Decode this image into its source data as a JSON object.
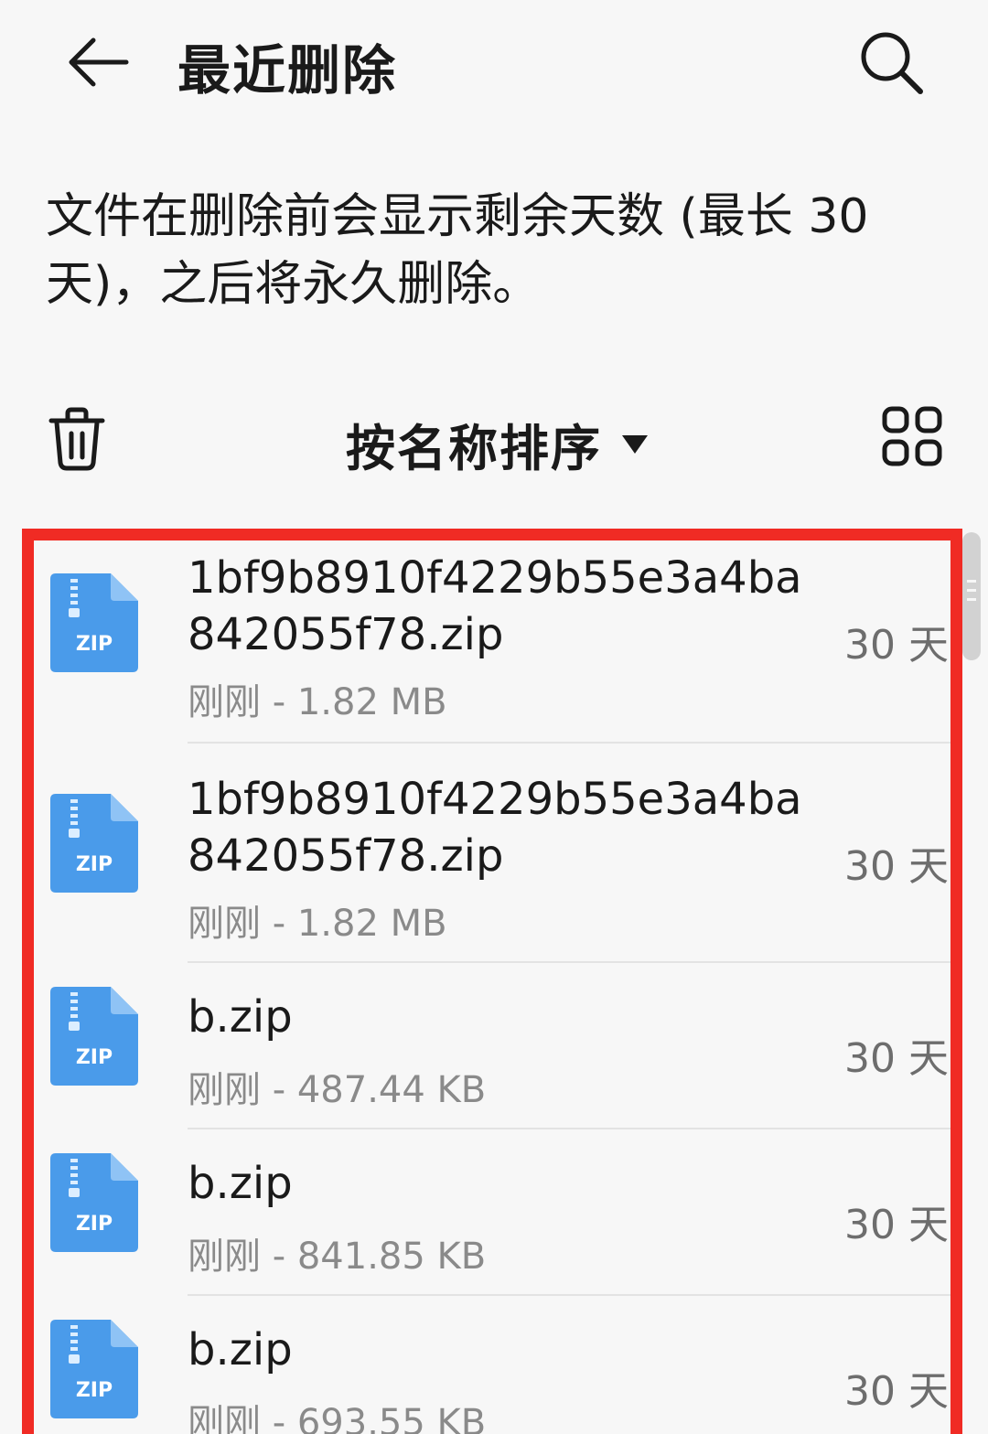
{
  "header": {
    "title": "最近删除",
    "back_icon": "back-arrow-icon",
    "search_icon": "search-icon"
  },
  "description": "文件在删除前会显示剩余天数 (最长 30 天)，之后将永久删除。",
  "toolbar": {
    "sort_label": "按名称排序",
    "trash_icon": "trash-icon",
    "grid_icon": "grid-view-icon"
  },
  "accent": {
    "highlight_border": "#f02b24",
    "zip_blue": "#4a9bea"
  },
  "files": [
    {
      "icon_label": "ZIP",
      "name": "1bf9b8910f4229b55e3a4ba842055f78.zip",
      "meta": "刚刚 - 1.82 MB",
      "days": "30 天"
    },
    {
      "icon_label": "ZIP",
      "name": "1bf9b8910f4229b55e3a4ba842055f78.zip",
      "meta": "刚刚 - 1.82 MB",
      "days": "30 天"
    },
    {
      "icon_label": "ZIP",
      "name": "b.zip",
      "meta": "刚刚 - 487.44 KB",
      "days": "30 天"
    },
    {
      "icon_label": "ZIP",
      "name": "b.zip",
      "meta": "刚刚 - 841.85 KB",
      "days": "30 天"
    },
    {
      "icon_label": "ZIP",
      "name": "b.zip",
      "meta": "刚刚 - 693.55 KB",
      "days": "30 天"
    }
  ]
}
